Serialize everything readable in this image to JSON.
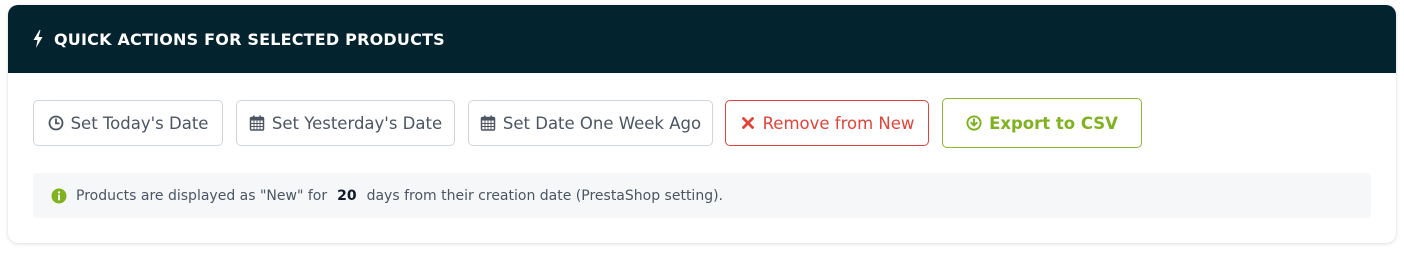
{
  "panel": {
    "title": "QUICK ACTIONS FOR SELECTED PRODUCTS",
    "title_icon": "bolt-icon"
  },
  "actions": {
    "set_today": {
      "label": "Set Today's Date",
      "icon": "clock-icon"
    },
    "set_yesterday": {
      "label": "Set Yesterday's Date",
      "icon": "calendar-icon"
    },
    "set_week_ago": {
      "label": "Set Date One Week Ago",
      "icon": "calendar-icon"
    },
    "remove_new": {
      "label": "Remove from New",
      "icon": "times-icon",
      "color": "#e0443a"
    },
    "export_csv": {
      "label": "Export to CSV",
      "icon": "download-circle-icon",
      "color": "#7fb21e"
    }
  },
  "info": {
    "icon": "info-circle-icon",
    "text_before": "Products are displayed as \"New\" for",
    "days": "20",
    "text_after": "days from their creation date (PrestaShop setting)."
  },
  "colors": {
    "header_bg": "#03232f",
    "info_icon": "#7fb21e"
  }
}
